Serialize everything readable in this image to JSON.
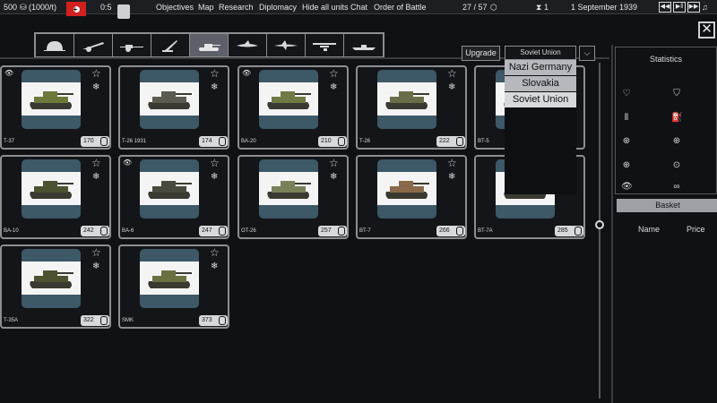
{
  "topbar": {
    "manpower": "500",
    "income": "(1000/t)",
    "units_ratio": "0:5",
    "menu": [
      "Objectives",
      "Map",
      "Research",
      "Diplomacy",
      "Hide all units",
      "Chat",
      "Order of Battle"
    ],
    "turn": "27 / 57",
    "timer": "1",
    "date": "1 September 1939"
  },
  "categories": [
    {
      "icon": "infantry-helmet-icon"
    },
    {
      "icon": "artillery-gun-icon"
    },
    {
      "icon": "field-gun-icon"
    },
    {
      "icon": "anti-air-gun-icon"
    },
    {
      "icon": "tank-icon",
      "active": true
    },
    {
      "icon": "fighter-plane-icon"
    },
    {
      "icon": "bomber-plane-icon"
    },
    {
      "icon": "transport-plane-icon"
    },
    {
      "icon": "ship-icon"
    }
  ],
  "controls": {
    "upgrade_label": "Upgrade",
    "nation_selected": "Soviet Union",
    "nation_options": [
      "Nazi Germany",
      "Slovakia",
      "Soviet Union"
    ],
    "close_label": "✕"
  },
  "stats": {
    "title": "Statistics",
    "basket_label": "Basket",
    "name_col": "Name",
    "price_col": "Price"
  },
  "units": [
    {
      "name": "T-37",
      "price": "170",
      "color": "#6b7a3a"
    },
    {
      "name": "T-26 1931",
      "price": "174",
      "color": "#5b5b50"
    },
    {
      "name": "BA-20",
      "price": "210",
      "color": "#6f7a44"
    },
    {
      "name": "T-26",
      "price": "222",
      "color": "#6a6e48"
    },
    {
      "name": "BT-5",
      "price": "",
      "color": "#5f6b40"
    },
    {
      "name": "BA-10",
      "price": "242",
      "color": "#4b5230"
    },
    {
      "name": "BA-6",
      "price": "247",
      "color": "#474a3c"
    },
    {
      "name": "OT-26",
      "price": "257",
      "color": "#78825a"
    },
    {
      "name": "BT-7",
      "price": "266",
      "color": "#8a6a4a"
    },
    {
      "name": "BT-7A",
      "price": "285",
      "color": "#5f6b40"
    },
    {
      "name": "T-35A",
      "price": "322",
      "color": "#4d5230"
    },
    {
      "name": "SMK",
      "price": "373",
      "color": "#6b7040"
    }
  ]
}
